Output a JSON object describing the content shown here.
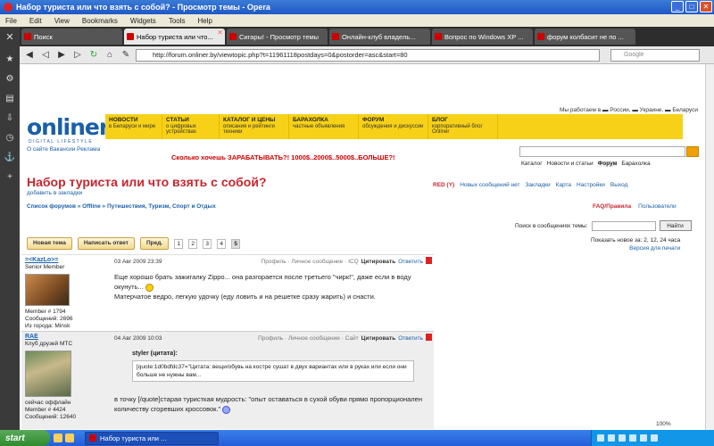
{
  "window": {
    "title": "Набор туриста или что взять с собой? - Просмотр темы - Opera"
  },
  "menu": [
    "File",
    "Edit",
    "View",
    "Bookmarks",
    "Widgets",
    "Tools",
    "Help"
  ],
  "tabs": [
    {
      "label": "Поиск",
      "active": false
    },
    {
      "label": "Набор туриста или что...",
      "active": true
    },
    {
      "label": "Сигары! - Просмотр темы",
      "active": false
    },
    {
      "label": "Онлайн-клуб владель...",
      "active": false
    },
    {
      "label": "Вопрос по Windows XP ...",
      "active": false
    },
    {
      "label": "форум колбасит не по ...",
      "active": false
    }
  ],
  "address": {
    "url": "http://forum.onliner.by/viewtopic.php?t=11961118postdays=0&postorder=asc&start=80",
    "search_placeholder": "Google"
  },
  "site": {
    "top_right": "Мы работаем в ▬ России, ▬ Украине, ▬ Беларуси",
    "logo": "onliner",
    "logo_sub": "DIGITAL LIFESTYLE",
    "nav": [
      {
        "title": "НОВОСТИ",
        "sub": "в Беларуси и мире"
      },
      {
        "title": "СТАТЬИ",
        "sub": "о цифровых устройствах"
      },
      {
        "title": "КАТАЛОГ И ЦЕНЫ",
        "sub": "описания и рейтинги техники"
      },
      {
        "title": "БАРАХОЛКА",
        "sub": "частные объявления"
      },
      {
        "title": "ФОРУМ",
        "sub": "обсуждения и дискуссии"
      },
      {
        "title": "БЛОГ",
        "sub": "корпоративный блог Onliner"
      }
    ],
    "site_links": "О сайте  Вакансии  Реклама",
    "promo": "Сколько хочешь ЗАРАБАТЫВАТЬ?! 1000$..2000$..5000$..БОЛЬШЕ?!",
    "section_nav": [
      "Каталог",
      "Новости и статьи",
      "Форум",
      "Барахолка"
    ]
  },
  "topic": {
    "title": "Набор туриста или что взять с собой?",
    "bookmark": "добавить в закладки",
    "user_links": [
      "RED (Y)",
      "Новых сообщений нет",
      "Закладки",
      "Карта",
      "Настройки",
      "Выход"
    ],
    "breadcrumb": "Список форумов » Offline » Путешествия, Туризм, Спорт и Отдых",
    "faq": "FAQ/Правила",
    "users": "Пользователи",
    "search_label": "Поиск в сообщениях темы:",
    "search_button": "Найти",
    "new_topic": "Новая тема",
    "reply": "Написать ответ",
    "prev": "Пред.",
    "pages": [
      "1",
      "2",
      "3",
      "4",
      "5"
    ],
    "show_new": "Показать новое за: 2, 12, 24 часа",
    "print_version": "Версия для печати"
  },
  "posts": [
    {
      "nick": "=<KazLo>=",
      "rank": "Senior Member",
      "member": "Member # 1794",
      "messages": "Сообщений: 2696",
      "city": "Из города: Minsk",
      "status": "",
      "date": "03 Авг 2009 23:39",
      "actions": "Профиль  ·  Личное сообщение  ·  ICQ",
      "cite": "Цитировать",
      "answer": "Ответить",
      "text1": "Еще хорошо брать зажигалку Zippo... она разгорается после третьего \"чирк!\", даже если в воду окунуть...",
      "text2": "Матерчатое ведро, легкую удочку (еду ловить и на решетке сразу жарить) и снасти."
    },
    {
      "nick": "RAE",
      "rank": "Клуб друзей МТС",
      "member": "Member # 4424",
      "messages": "Сообщений: 12640",
      "city": "",
      "status": "сейчас оффлайн",
      "date": "04 Авг 2009 10:03",
      "actions": "Профиль  ·  Личное сообщение  ·  Сайт",
      "cite": "Цитировать",
      "answer": "Ответить",
      "quote_head": "styler (цитата):",
      "quote": "[quote:1d0bdfdc37=\"Цитата: вещи/обувь на костре сушат в двух вариантах или в руках или если они больше не нужны вам...",
      "text1": "в точку [/quote]старая туристкая мудрость: \"опыт оставаться в сухой обуви прямо пропорционален количеству сгоревших кроссовок.\""
    }
  ],
  "status": {
    "zoom": "100%"
  },
  "taskbar": {
    "start": "start",
    "task": "Набор туриста или ..."
  }
}
